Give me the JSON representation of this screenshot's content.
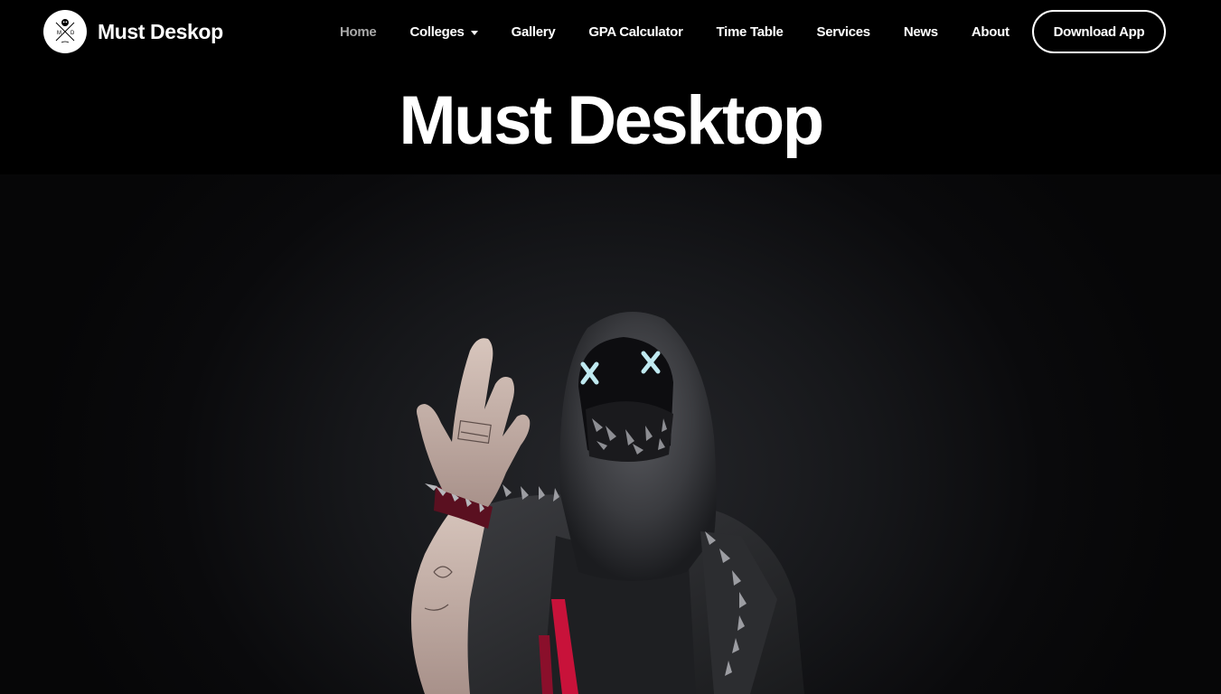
{
  "brand": {
    "name": "Must Deskop",
    "logo_icon": "md-monogram-logo"
  },
  "nav": {
    "items": [
      {
        "label": "Home",
        "active": true
      },
      {
        "label": "Colleges",
        "has_dropdown": true
      },
      {
        "label": "Gallery"
      },
      {
        "label": "GPA Calculator"
      },
      {
        "label": "Time Table"
      },
      {
        "label": "Services"
      },
      {
        "label": "News"
      },
      {
        "label": "About"
      }
    ],
    "cta_label": "Download App"
  },
  "hero": {
    "title": "Must Desktop",
    "image_icon": "hooded-masked-figure-image"
  },
  "colors": {
    "background": "#000000",
    "text": "#ffffff",
    "nav_active": "#a8a8a8",
    "mask_glow": "#bfe9f0",
    "accent_red": "#c8123a"
  }
}
